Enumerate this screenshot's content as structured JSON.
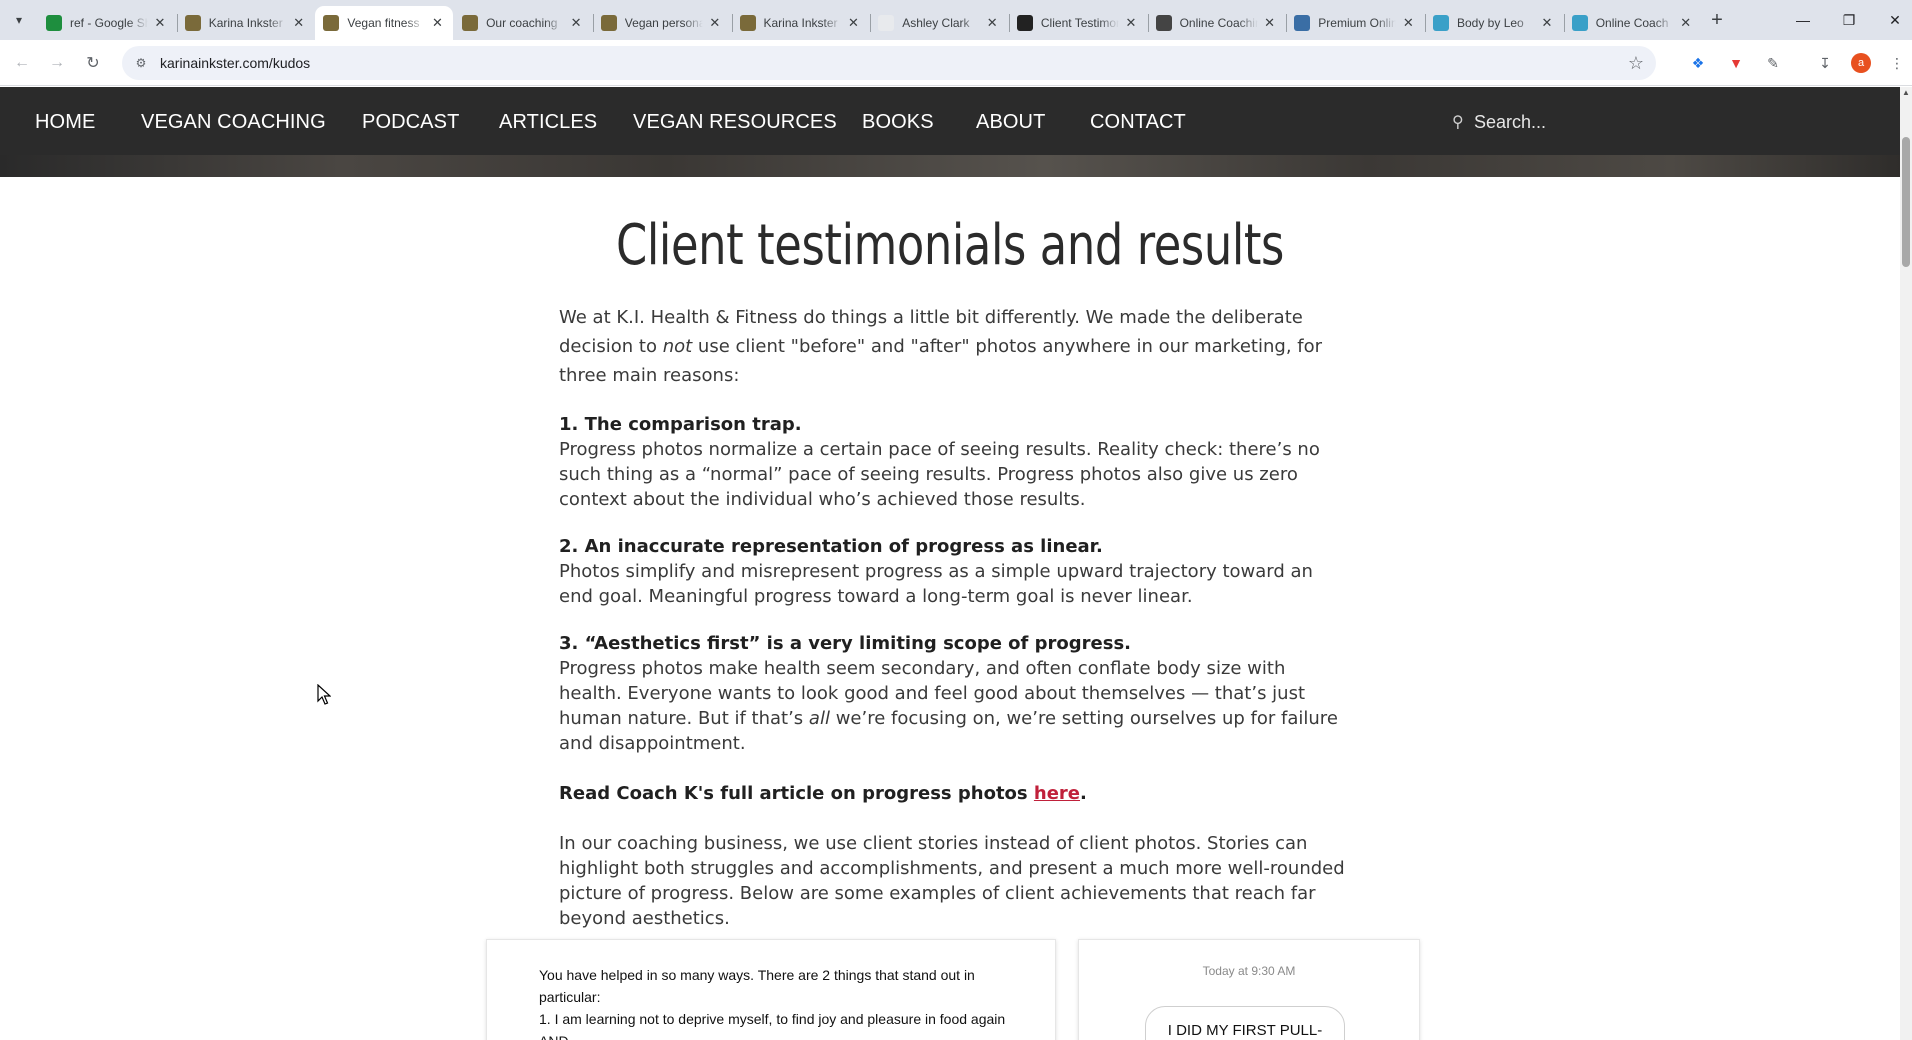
{
  "browser": {
    "tabs": [
      {
        "title": "ref - Google Sheets",
        "favicon": "sheets-icon",
        "color": "#1e8e3e"
      },
      {
        "title": "Karina Inkster",
        "favicon": "site-icon",
        "color": "#7a6a3a"
      },
      {
        "title": "Vegan fitness",
        "favicon": "site-icon",
        "color": "#7a6a3a",
        "active": true
      },
      {
        "title": "Our coaching",
        "favicon": "site-icon",
        "color": "#7a6a3a"
      },
      {
        "title": "Vegan personal",
        "favicon": "site-icon",
        "color": "#7a6a3a"
      },
      {
        "title": "Karina Inkster",
        "favicon": "site-icon",
        "color": "#7a6a3a"
      },
      {
        "title": "Ashley Clark",
        "favicon": "blank-icon",
        "color": "#e8eaed"
      },
      {
        "title": "Client Testimonials",
        "favicon": "site-icon",
        "color": "#222222"
      },
      {
        "title": "Online Coaching",
        "favicon": "cube-icon",
        "color": "#444444"
      },
      {
        "title": "Premium Online",
        "favicon": "wordpress-icon",
        "color": "#3a6ea5"
      },
      {
        "title": "Body by Leo",
        "favicon": "leaf-icon",
        "color": "#3aa0c8"
      },
      {
        "title": "Online Coach",
        "favicon": "leaf-icon",
        "color": "#3aa0c8"
      }
    ],
    "url": "karinainkster.com/kudos",
    "profile_initial": "a",
    "accent": "#e8501f"
  },
  "site": {
    "nav": [
      "HOME",
      "VEGAN COACHING",
      "PODCAST",
      "ARTICLES",
      "VEGAN RESOURCES",
      "BOOKS",
      "ABOUT",
      "CONTACT"
    ],
    "search_placeholder": "Search...",
    "link_color": "#c0203a"
  },
  "page": {
    "title": "Client testimonials and results",
    "intro_a": "We at K.I. Health & Fitness do things a little bit differently. We made the deliberate decision to ",
    "intro_em": "not",
    "intro_b": " use client \"before\" and \"after\" photos anywhere in our marketing, for three main reasons:",
    "reasons": [
      {
        "head": "1. The comparison trap.",
        "body": "Progress photos normalize a certain pace of seeing results. Reality check: there’s no such thing as a “normal” pace of seeing results. Progress photos also give us zero context about the individual who’s achieved those results."
      },
      {
        "head": "2. An inaccurate representation of progress as linear.",
        "body": "Photos simplify and misrepresent progress as a simple upward trajectory toward an end goal. Meaningful progress toward a long-term goal is never linear."
      },
      {
        "head": "3. “Aesthetics first” is a very limiting scope of progress.",
        "body_a": "Progress photos make health seem secondary, and often conflate body size with health. Everyone wants to look good and feel good about themselves — that’s just human nature. But if that’s ",
        "body_em": "all",
        "body_b": " we’re focusing on, we’re setting ourselves up for failure and disappointment."
      }
    ],
    "read_more_text": "Read Coach K's full article on progress photos ",
    "read_more_link": "here",
    "read_more_end": ".",
    "outro": "In our coaching business, we use client stories instead of client photos. Stories can highlight both struggles and accomplishments, and present a much more well-rounded picture of progress. Below are some examples of client achievements that reach far beyond aesthetics."
  },
  "testimonials": {
    "left_text": "You have helped in so many ways. There are 2 things that stand out in particular:\n1. I am learning not to deprive myself, to find joy and pleasure in food again AND",
    "right_time": "Today at 9:30 AM",
    "right_bubble": "I DID MY FIRST PULL-"
  }
}
